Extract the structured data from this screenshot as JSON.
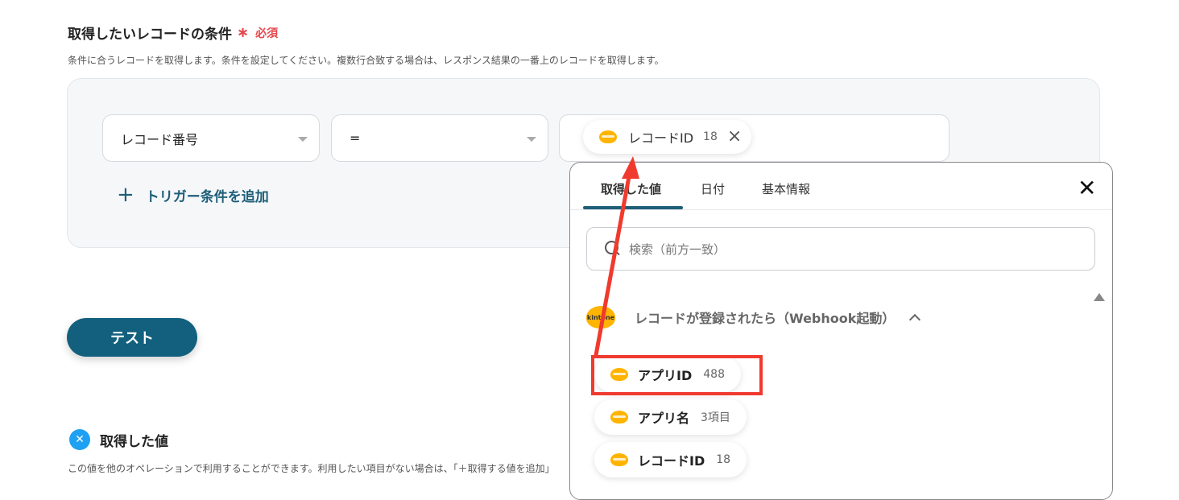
{
  "section": {
    "title": "取得したいレコードの条件",
    "required_label": "必須",
    "description": "条件に合うレコードを取得します。条件を設定してください。複数行合致する場合は、レスポンス結果の一番上のレコードを取得します。"
  },
  "condition": {
    "field_select": "レコード番号",
    "operator_select": "=",
    "value_chip": {
      "label": "レコードID",
      "value": "18"
    },
    "add_condition": "トリガー条件を追加",
    "add_icon": "plus-icon"
  },
  "test_button": "テスト",
  "obtained": {
    "title": "取得した値",
    "description": "この値を他のオペレーションで利用することができます。利用したい項目がない場合は、「＋取得する値を追加」",
    "icon": "yoom-icon"
  },
  "picker": {
    "tabs": [
      {
        "label": "取得した値",
        "active": true
      },
      {
        "label": "日付",
        "active": false
      },
      {
        "label": "基本情報",
        "active": false
      }
    ],
    "search_placeholder": "検索（前方一致）",
    "group": {
      "logo_text": "kintone",
      "label": "レコードが登録されたら（Webhook起動）",
      "expanded": true
    },
    "items": [
      {
        "label": "アプリID",
        "value": "488",
        "highlighted": true
      },
      {
        "label": "アプリ名",
        "value": "3項目",
        "highlighted": false
      },
      {
        "label": "レコードID",
        "value": "18",
        "highlighted": false
      }
    ]
  },
  "colors": {
    "primary": "#12607e",
    "required": "#e5484d",
    "annotation": "#f03a2e",
    "kintone": "#ffb400"
  }
}
